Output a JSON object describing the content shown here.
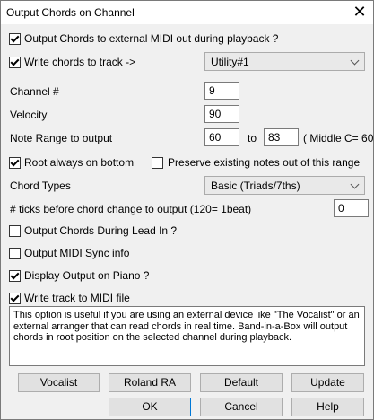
{
  "window": {
    "title": "Output Chords on Channel",
    "close_icon": "close-icon"
  },
  "options": {
    "output_external": {
      "label": "Output Chords to external MIDI out during playback ?",
      "checked": true
    },
    "write_to_track": {
      "label": "Write chords to track ->",
      "checked": true,
      "track_value": "Utility#1"
    },
    "channel": {
      "label": "Channel #",
      "value": "9"
    },
    "velocity": {
      "label": "Velocity",
      "value": "90"
    },
    "note_range": {
      "label": "Note Range to output",
      "from": "60",
      "to_label": "to",
      "to": "83",
      "hint": "( Middle C= 60 )"
    },
    "root_bottom": {
      "label": "Root always on bottom",
      "checked": true
    },
    "preserve_notes": {
      "label": "Preserve existing notes out of this range",
      "checked": false
    },
    "chord_types": {
      "label": "Chord Types",
      "value": "Basic (Triads/7ths)"
    },
    "ticks": {
      "label": "# ticks before chord change to output (120= 1beat)",
      "value": "0"
    },
    "lead_in": {
      "label": "Output Chords During Lead In ?",
      "checked": false
    },
    "midi_sync": {
      "label": "Output MIDI Sync info",
      "checked": false
    },
    "display_piano": {
      "label": "Display Output on Piano ?",
      "checked": true
    },
    "write_midi_file": {
      "label": "Write track to MIDI file",
      "checked": true
    }
  },
  "help_text": "This option is useful if you are using an external device like \"The Vocalist\" or an external arranger that can read chords in real time. Band-in-a-Box will output chords in root position on the selected channel during playback.",
  "buttons": {
    "vocalist": "Vocalist",
    "roland_ra": "Roland RA",
    "default": "Default",
    "update": "Update",
    "ok": "OK",
    "cancel": "Cancel",
    "help": "Help"
  }
}
